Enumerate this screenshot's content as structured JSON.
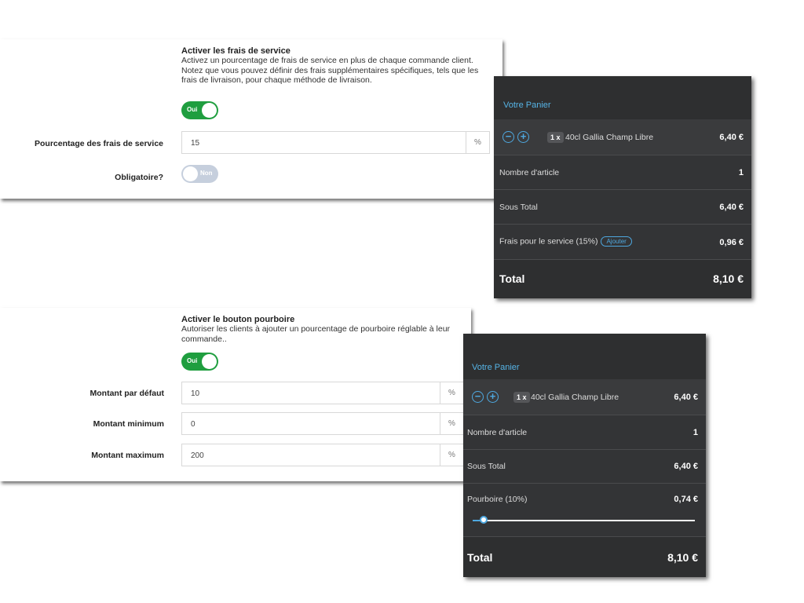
{
  "service_fee": {
    "title": "Activer les frais de service",
    "description_lines": [
      "Activez un pourcentage de frais de service en plus de chaque commande client.",
      "Notez que vous pouvez définir des frais supplémentaires spécifiques, tels que les",
      "frais de livraison, pour chaque méthode de livraison."
    ],
    "toggle_label": "Oui",
    "percentage_label": "Pourcentage des frais de service",
    "percentage_value": "15",
    "percentage_suffix": "%",
    "mandatory_label": "Obligatoire?",
    "mandatory_toggle_label": "Non"
  },
  "tip": {
    "title": "Activer le bouton pourboire",
    "description_lines": [
      "Autoriser les clients à ajouter un pourcentage de pourboire réglable à leur",
      "commande.."
    ],
    "toggle_label": "Oui",
    "fields": [
      {
        "label": "Montant par défaut",
        "value": "10",
        "suffix": "%"
      },
      {
        "label": "Montant minimum",
        "value": "0",
        "suffix": "%"
      },
      {
        "label": "Montant maximum",
        "value": "200",
        "suffix": "%"
      }
    ]
  },
  "cart_service": {
    "title": "Votre Panier",
    "item": {
      "minus": "−",
      "plus": "+",
      "qty": "1 x",
      "name": "40cl Gallia Champ Libre",
      "price": "6,40 €"
    },
    "count_label": "Nombre d'article",
    "count_value": "1",
    "subtotal_label": "Sous Total",
    "subtotal_value": "6,40 €",
    "fee_label": "Frais pour le service (15%)",
    "fee_button": "Ajouter",
    "fee_value": "0,96 €",
    "total_label": "Total",
    "total_value": "8,10 €"
  },
  "cart_tip": {
    "title": "Votre Panier",
    "item": {
      "minus": "−",
      "plus": "+",
      "qty": "1 x",
      "name": "40cl Gallia Champ Libre",
      "price": "6,40 €"
    },
    "count_label": "Nombre d'article",
    "count_value": "1",
    "subtotal_label": "Sous Total",
    "subtotal_value": "6,40 €",
    "tip_label": "Pourboire (10%)",
    "tip_value": "0,74 €",
    "tip_slider_fraction": 0.05,
    "total_label": "Total",
    "total_value": "8,10 €"
  },
  "colors": {
    "toggle_on": "#1f9e3f",
    "toggle_off": "#c6cfdd",
    "cart_bg": "#2e2f30",
    "accent_blue": "#4ea8e0"
  }
}
